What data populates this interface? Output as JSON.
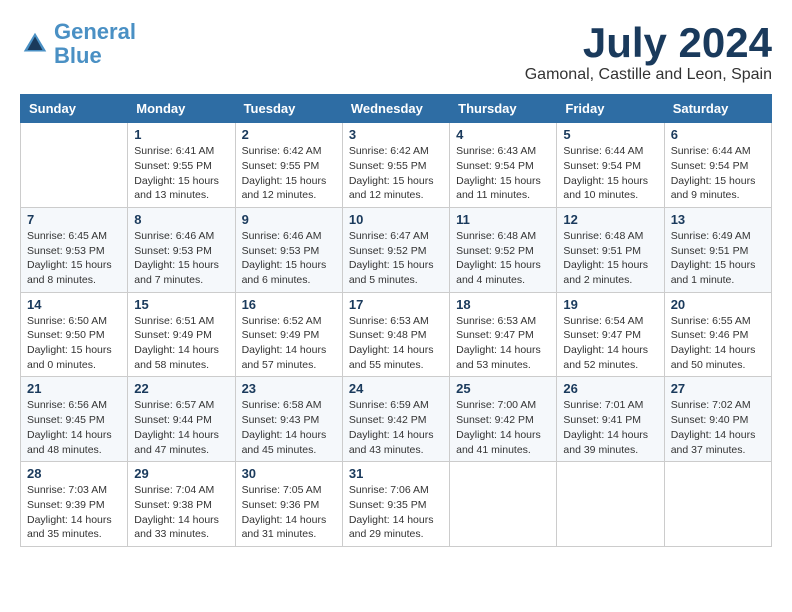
{
  "logo": {
    "text_general": "General",
    "text_blue": "Blue"
  },
  "title": "July 2024",
  "subtitle": "Gamonal, Castille and Leon, Spain",
  "weekdays": [
    "Sunday",
    "Monday",
    "Tuesday",
    "Wednesday",
    "Thursday",
    "Friday",
    "Saturday"
  ],
  "weeks": [
    [
      {
        "day": "",
        "info": ""
      },
      {
        "day": "1",
        "info": "Sunrise: 6:41 AM\nSunset: 9:55 PM\nDaylight: 15 hours\nand 13 minutes."
      },
      {
        "day": "2",
        "info": "Sunrise: 6:42 AM\nSunset: 9:55 PM\nDaylight: 15 hours\nand 12 minutes."
      },
      {
        "day": "3",
        "info": "Sunrise: 6:42 AM\nSunset: 9:55 PM\nDaylight: 15 hours\nand 12 minutes."
      },
      {
        "day": "4",
        "info": "Sunrise: 6:43 AM\nSunset: 9:54 PM\nDaylight: 15 hours\nand 11 minutes."
      },
      {
        "day": "5",
        "info": "Sunrise: 6:44 AM\nSunset: 9:54 PM\nDaylight: 15 hours\nand 10 minutes."
      },
      {
        "day": "6",
        "info": "Sunrise: 6:44 AM\nSunset: 9:54 PM\nDaylight: 15 hours\nand 9 minutes."
      }
    ],
    [
      {
        "day": "7",
        "info": "Sunrise: 6:45 AM\nSunset: 9:53 PM\nDaylight: 15 hours\nand 8 minutes."
      },
      {
        "day": "8",
        "info": "Sunrise: 6:46 AM\nSunset: 9:53 PM\nDaylight: 15 hours\nand 7 minutes."
      },
      {
        "day": "9",
        "info": "Sunrise: 6:46 AM\nSunset: 9:53 PM\nDaylight: 15 hours\nand 6 minutes."
      },
      {
        "day": "10",
        "info": "Sunrise: 6:47 AM\nSunset: 9:52 PM\nDaylight: 15 hours\nand 5 minutes."
      },
      {
        "day": "11",
        "info": "Sunrise: 6:48 AM\nSunset: 9:52 PM\nDaylight: 15 hours\nand 4 minutes."
      },
      {
        "day": "12",
        "info": "Sunrise: 6:48 AM\nSunset: 9:51 PM\nDaylight: 15 hours\nand 2 minutes."
      },
      {
        "day": "13",
        "info": "Sunrise: 6:49 AM\nSunset: 9:51 PM\nDaylight: 15 hours\nand 1 minute."
      }
    ],
    [
      {
        "day": "14",
        "info": "Sunrise: 6:50 AM\nSunset: 9:50 PM\nDaylight: 15 hours\nand 0 minutes."
      },
      {
        "day": "15",
        "info": "Sunrise: 6:51 AM\nSunset: 9:49 PM\nDaylight: 14 hours\nand 58 minutes."
      },
      {
        "day": "16",
        "info": "Sunrise: 6:52 AM\nSunset: 9:49 PM\nDaylight: 14 hours\nand 57 minutes."
      },
      {
        "day": "17",
        "info": "Sunrise: 6:53 AM\nSunset: 9:48 PM\nDaylight: 14 hours\nand 55 minutes."
      },
      {
        "day": "18",
        "info": "Sunrise: 6:53 AM\nSunset: 9:47 PM\nDaylight: 14 hours\nand 53 minutes."
      },
      {
        "day": "19",
        "info": "Sunrise: 6:54 AM\nSunset: 9:47 PM\nDaylight: 14 hours\nand 52 minutes."
      },
      {
        "day": "20",
        "info": "Sunrise: 6:55 AM\nSunset: 9:46 PM\nDaylight: 14 hours\nand 50 minutes."
      }
    ],
    [
      {
        "day": "21",
        "info": "Sunrise: 6:56 AM\nSunset: 9:45 PM\nDaylight: 14 hours\nand 48 minutes."
      },
      {
        "day": "22",
        "info": "Sunrise: 6:57 AM\nSunset: 9:44 PM\nDaylight: 14 hours\nand 47 minutes."
      },
      {
        "day": "23",
        "info": "Sunrise: 6:58 AM\nSunset: 9:43 PM\nDaylight: 14 hours\nand 45 minutes."
      },
      {
        "day": "24",
        "info": "Sunrise: 6:59 AM\nSunset: 9:42 PM\nDaylight: 14 hours\nand 43 minutes."
      },
      {
        "day": "25",
        "info": "Sunrise: 7:00 AM\nSunset: 9:42 PM\nDaylight: 14 hours\nand 41 minutes."
      },
      {
        "day": "26",
        "info": "Sunrise: 7:01 AM\nSunset: 9:41 PM\nDaylight: 14 hours\nand 39 minutes."
      },
      {
        "day": "27",
        "info": "Sunrise: 7:02 AM\nSunset: 9:40 PM\nDaylight: 14 hours\nand 37 minutes."
      }
    ],
    [
      {
        "day": "28",
        "info": "Sunrise: 7:03 AM\nSunset: 9:39 PM\nDaylight: 14 hours\nand 35 minutes."
      },
      {
        "day": "29",
        "info": "Sunrise: 7:04 AM\nSunset: 9:38 PM\nDaylight: 14 hours\nand 33 minutes."
      },
      {
        "day": "30",
        "info": "Sunrise: 7:05 AM\nSunset: 9:36 PM\nDaylight: 14 hours\nand 31 minutes."
      },
      {
        "day": "31",
        "info": "Sunrise: 7:06 AM\nSunset: 9:35 PM\nDaylight: 14 hours\nand 29 minutes."
      },
      {
        "day": "",
        "info": ""
      },
      {
        "day": "",
        "info": ""
      },
      {
        "day": "",
        "info": ""
      }
    ]
  ]
}
